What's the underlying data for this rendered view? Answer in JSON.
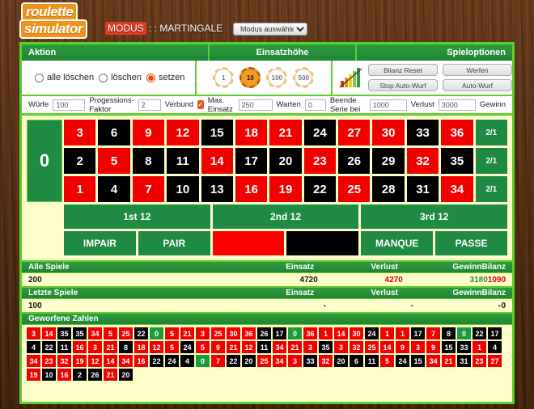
{
  "header": {
    "logo_line1": "roulette",
    "logo_line2": "simulator",
    "modus_prefix": "MODUS",
    "modus_sep": " : : ",
    "modus_value": "MARTINGALE",
    "mode_select_value": "Modus auswählen"
  },
  "sections": {
    "aktion": "Aktion",
    "einsatzhoehe": "Einsatzhöhe",
    "spieloptionen": "Spieloptionen"
  },
  "actions": {
    "options": [
      {
        "label": "alle löschen",
        "selected": false
      },
      {
        "label": "löschen",
        "selected": false
      },
      {
        "label": "setzen",
        "selected": true
      }
    ]
  },
  "chips": [
    {
      "value": "1",
      "active": false
    },
    {
      "value": "10",
      "active": true
    },
    {
      "value": "100",
      "active": false
    },
    {
      "value": "500",
      "active": false
    }
  ],
  "game_options": {
    "chart_icon": "bar-chart-icon",
    "bilanz_reset": "Bilanz Reset",
    "stop_auto_wurf": "Stop Auto-Wurf",
    "werfen": "Werfen",
    "auto_wurf": "Auto-Wurf"
  },
  "settings": {
    "wuerfe_label": "Würfe",
    "wuerfe_value": "100",
    "progression_label": "Progessions-Faktor",
    "progression_value": "2",
    "verbund_label": "Verbund",
    "verbund_checked": true,
    "max_einsatz_label": "Max. Einsatz",
    "max_einsatz_value": "250",
    "warten_label": "Warten",
    "warten_value": "0",
    "beende_label": "Beende Serie bei",
    "beende_value": "1000",
    "verlust_label": "Verlust",
    "verlust_value": "3000",
    "gewinn_label": "Gewinn"
  },
  "table": {
    "zero": "0",
    "column_bet_label": "2/1",
    "numbers": [
      {
        "n": "3",
        "c": "red"
      },
      {
        "n": "6",
        "c": "black"
      },
      {
        "n": "9",
        "c": "red"
      },
      {
        "n": "12",
        "c": "red"
      },
      {
        "n": "15",
        "c": "black"
      },
      {
        "n": "18",
        "c": "red"
      },
      {
        "n": "21",
        "c": "red"
      },
      {
        "n": "24",
        "c": "black"
      },
      {
        "n": "27",
        "c": "red"
      },
      {
        "n": "30",
        "c": "red"
      },
      {
        "n": "33",
        "c": "black"
      },
      {
        "n": "36",
        "c": "red"
      },
      {
        "n": "2",
        "c": "black"
      },
      {
        "n": "5",
        "c": "red"
      },
      {
        "n": "8",
        "c": "black"
      },
      {
        "n": "11",
        "c": "black"
      },
      {
        "n": "14",
        "c": "red"
      },
      {
        "n": "17",
        "c": "black"
      },
      {
        "n": "20",
        "c": "black"
      },
      {
        "n": "23",
        "c": "red"
      },
      {
        "n": "26",
        "c": "black"
      },
      {
        "n": "29",
        "c": "black"
      },
      {
        "n": "32",
        "c": "red"
      },
      {
        "n": "35",
        "c": "black"
      },
      {
        "n": "1",
        "c": "red"
      },
      {
        "n": "4",
        "c": "black"
      },
      {
        "n": "7",
        "c": "red"
      },
      {
        "n": "10",
        "c": "black"
      },
      {
        "n": "13",
        "c": "black"
      },
      {
        "n": "16",
        "c": "red"
      },
      {
        "n": "19",
        "c": "red"
      },
      {
        "n": "22",
        "c": "black"
      },
      {
        "n": "25",
        "c": "red"
      },
      {
        "n": "28",
        "c": "black"
      },
      {
        "n": "31",
        "c": "black"
      },
      {
        "n": "34",
        "c": "red"
      }
    ],
    "dozens": [
      "1st 12",
      "2nd 12",
      "3rd 12"
    ],
    "evens": [
      {
        "label": "IMPAIR",
        "kind": "green"
      },
      {
        "label": "PAIR",
        "kind": "green"
      },
      {
        "label": "",
        "kind": "red"
      },
      {
        "label": "",
        "kind": "black"
      },
      {
        "label": "MANQUE",
        "kind": "green"
      },
      {
        "label": "PASSE",
        "kind": "green"
      }
    ]
  },
  "stats": {
    "columns": [
      "Einsatz",
      "Verlust",
      "Gewinn",
      "Bilanz"
    ],
    "all_games": {
      "title": "Alle Spiele",
      "count": "200",
      "einsatz": "4720",
      "verlust": "4270",
      "gewinn": "3180",
      "bilanz": "1090"
    },
    "last_games": {
      "title": "Letzte Spiele",
      "count": "100",
      "einsatz": "-",
      "verlust": "-",
      "gewinn": "-",
      "bilanz": "0"
    }
  },
  "thrown": {
    "title": "Geworfene Zahlen",
    "numbers": [
      {
        "n": "3",
        "c": "red"
      },
      {
        "n": "14",
        "c": "red"
      },
      {
        "n": "35",
        "c": "black"
      },
      {
        "n": "35",
        "c": "black"
      },
      {
        "n": "34",
        "c": "red"
      },
      {
        "n": "5",
        "c": "red"
      },
      {
        "n": "25",
        "c": "red"
      },
      {
        "n": "22",
        "c": "black"
      },
      {
        "n": "0",
        "c": "green"
      },
      {
        "n": "5",
        "c": "red"
      },
      {
        "n": "21",
        "c": "red"
      },
      {
        "n": "3",
        "c": "red"
      },
      {
        "n": "25",
        "c": "red"
      },
      {
        "n": "30",
        "c": "red"
      },
      {
        "n": "36",
        "c": "red"
      },
      {
        "n": "26",
        "c": "black"
      },
      {
        "n": "17",
        "c": "black"
      },
      {
        "n": "0",
        "c": "green"
      },
      {
        "n": "36",
        "c": "red"
      },
      {
        "n": "1",
        "c": "red"
      },
      {
        "n": "14",
        "c": "red"
      },
      {
        "n": "30",
        "c": "red"
      },
      {
        "n": "24",
        "c": "black"
      },
      {
        "n": "1",
        "c": "red"
      },
      {
        "n": "1",
        "c": "red"
      },
      {
        "n": "17",
        "c": "black"
      },
      {
        "n": "7",
        "c": "red"
      },
      {
        "n": "8",
        "c": "black"
      },
      {
        "n": "0",
        "c": "green"
      },
      {
        "n": "22",
        "c": "black"
      },
      {
        "n": "17",
        "c": "black"
      },
      {
        "n": "4",
        "c": "black"
      },
      {
        "n": "22",
        "c": "black"
      },
      {
        "n": "11",
        "c": "black"
      },
      {
        "n": "16",
        "c": "red"
      },
      {
        "n": "3",
        "c": "red"
      },
      {
        "n": "21",
        "c": "red"
      },
      {
        "n": "8",
        "c": "black"
      },
      {
        "n": "18",
        "c": "red"
      },
      {
        "n": "12",
        "c": "red"
      },
      {
        "n": "5",
        "c": "red"
      },
      {
        "n": "24",
        "c": "black"
      },
      {
        "n": "5",
        "c": "red"
      },
      {
        "n": "9",
        "c": "red"
      },
      {
        "n": "21",
        "c": "red"
      },
      {
        "n": "12",
        "c": "red"
      },
      {
        "n": "11",
        "c": "black"
      },
      {
        "n": "34",
        "c": "red"
      },
      {
        "n": "21",
        "c": "red"
      },
      {
        "n": "3",
        "c": "red"
      },
      {
        "n": "35",
        "c": "black"
      },
      {
        "n": "3",
        "c": "red"
      },
      {
        "n": "32",
        "c": "red"
      },
      {
        "n": "25",
        "c": "red"
      },
      {
        "n": "14",
        "c": "red"
      },
      {
        "n": "9",
        "c": "red"
      },
      {
        "n": "3",
        "c": "red"
      },
      {
        "n": "9",
        "c": "red"
      },
      {
        "n": "15",
        "c": "black"
      },
      {
        "n": "33",
        "c": "black"
      },
      {
        "n": "1",
        "c": "red"
      },
      {
        "n": "4",
        "c": "black"
      },
      {
        "n": "34",
        "c": "red"
      },
      {
        "n": "23",
        "c": "red"
      },
      {
        "n": "32",
        "c": "red"
      },
      {
        "n": "19",
        "c": "red"
      },
      {
        "n": "12",
        "c": "red"
      },
      {
        "n": "14",
        "c": "red"
      },
      {
        "n": "34",
        "c": "red"
      },
      {
        "n": "16",
        "c": "red"
      },
      {
        "n": "22",
        "c": "black"
      },
      {
        "n": "24",
        "c": "black"
      },
      {
        "n": "4",
        "c": "black"
      },
      {
        "n": "0",
        "c": "green"
      },
      {
        "n": "7",
        "c": "red"
      },
      {
        "n": "22",
        "c": "black"
      },
      {
        "n": "20",
        "c": "black"
      },
      {
        "n": "25",
        "c": "red"
      },
      {
        "n": "34",
        "c": "red"
      },
      {
        "n": "3",
        "c": "red"
      },
      {
        "n": "33",
        "c": "black"
      },
      {
        "n": "32",
        "c": "red"
      },
      {
        "n": "20",
        "c": "black"
      },
      {
        "n": "6",
        "c": "black"
      },
      {
        "n": "11",
        "c": "black"
      },
      {
        "n": "5",
        "c": "red"
      },
      {
        "n": "24",
        "c": "black"
      },
      {
        "n": "15",
        "c": "black"
      },
      {
        "n": "34",
        "c": "red"
      },
      {
        "n": "21",
        "c": "red"
      },
      {
        "n": "31",
        "c": "black"
      },
      {
        "n": "23",
        "c": "red"
      },
      {
        "n": "27",
        "c": "red"
      },
      {
        "n": "19",
        "c": "red"
      },
      {
        "n": "10",
        "c": "black"
      },
      {
        "n": "16",
        "c": "red"
      },
      {
        "n": "2",
        "c": "black"
      },
      {
        "n": "26",
        "c": "black"
      },
      {
        "n": "21",
        "c": "red"
      },
      {
        "n": "20",
        "c": "black"
      }
    ]
  },
  "colors": {
    "accent_green": "#5ad02a",
    "header_green": "#1f8433",
    "table_green": "#1f8a42",
    "red": "#f20000",
    "black": "#000000",
    "cream": "#ffffcc",
    "orange": "#f0921c",
    "loss_red": "#e00000"
  }
}
